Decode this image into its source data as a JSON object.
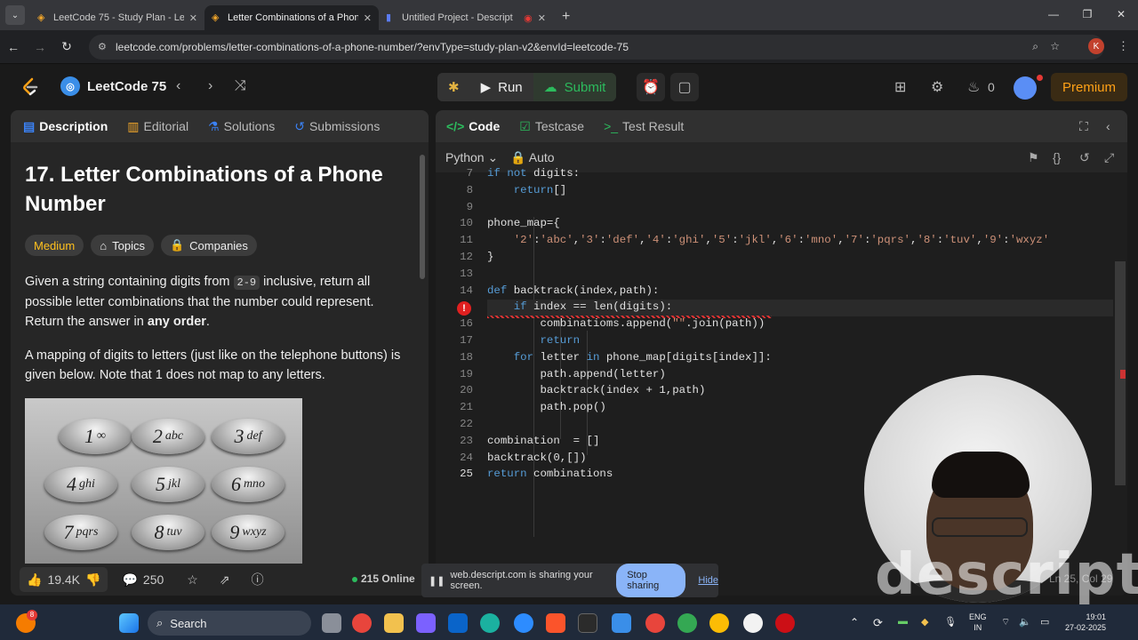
{
  "browser": {
    "tabs": [
      {
        "title": "LeetCode 75 - Study Plan - LeetCode"
      },
      {
        "title": "Letter Combinations of a Phone Number"
      },
      {
        "title": "Untitled Project - Descript"
      }
    ],
    "url": "leetcode.com/problems/letter-combinations-of-a-phone-number/?envType=study-plan-v2&envId=leetcode-75",
    "profile_initial": "K"
  },
  "header": {
    "study_plan": "LeetCode 75",
    "run": "Run",
    "submit": "Submit",
    "streak": "0",
    "premium": "Premium"
  },
  "left_tabs": [
    "Description",
    "Editorial",
    "Solutions",
    "Submissions"
  ],
  "problem": {
    "title": "17. Letter Combinations of a Phone Number",
    "difficulty": "Medium",
    "topics": "Topics",
    "companies": "Companies",
    "p1_a": "Given a string containing digits from ",
    "p1_code": "2-9",
    "p1_b": " inclusive, return all possible letter combinations that the number could represent. Return the answer in ",
    "p1_bold": "any order",
    "p1_c": ".",
    "p2": "A mapping of digits to letters (just like on the telephone buttons) is given below. Note that 1 does not map to any letters.",
    "keypad": [
      {
        "d": "1",
        "l": "∞"
      },
      {
        "d": "2",
        "l": "abc"
      },
      {
        "d": "3",
        "l": "def"
      },
      {
        "d": "4",
        "l": "ghi"
      },
      {
        "d": "5",
        "l": "jkl"
      },
      {
        "d": "6",
        "l": "mno"
      },
      {
        "d": "7",
        "l": "pqrs"
      },
      {
        "d": "8",
        "l": "tuv"
      },
      {
        "d": "9",
        "l": "wxyz"
      }
    ]
  },
  "footer": {
    "likes": "19.4K",
    "comments": "250",
    "online": "215 Online"
  },
  "editor_tabs": [
    "Code",
    "Testcase",
    "Test Result"
  ],
  "editor": {
    "language": "Python",
    "mode": "Auto",
    "status": "Ln 25, Col 29",
    "lines": [
      {
        "n": "7",
        "t": "if not digits:"
      },
      {
        "n": "8",
        "t": "    return[]"
      },
      {
        "n": "9",
        "t": ""
      },
      {
        "n": "10",
        "t": "phone_map={"
      },
      {
        "n": "11",
        "t": "    '2':'abc','3':'def','4':'ghi','5':'jkl','6':'mno','7':'pqrs','8':'tuv','9':'wxyz'"
      },
      {
        "n": "12",
        "t": "}"
      },
      {
        "n": "13",
        "t": ""
      },
      {
        "n": "14",
        "t": "def backtrack(index,path):"
      },
      {
        "n": "15",
        "t": "    if index == len(digits):"
      },
      {
        "n": "16",
        "t": "        combinatioms.append(\"\".join(path))"
      },
      {
        "n": "17",
        "t": "        return"
      },
      {
        "n": "18",
        "t": "    for letter in phone_map[digits[index]]:"
      },
      {
        "n": "19",
        "t": "        path.append(letter)"
      },
      {
        "n": "20",
        "t": "        backtrack(index + 1,path)"
      },
      {
        "n": "21",
        "t": "        path.pop()"
      },
      {
        "n": "22",
        "t": ""
      },
      {
        "n": "23",
        "t": "combination  = []"
      },
      {
        "n": "24",
        "t": "backtrack(0,[])"
      },
      {
        "n": "25",
        "t": "return combinations"
      }
    ]
  },
  "sharing": {
    "text": "web.descript.com is sharing your screen.",
    "stop": "Stop sharing",
    "hide": "Hide"
  },
  "watermark": "descript",
  "taskbar": {
    "search": "Search",
    "lang": "ENG",
    "region": "IN",
    "time": "19:01",
    "date": "27-02-2025",
    "badge": "8"
  }
}
